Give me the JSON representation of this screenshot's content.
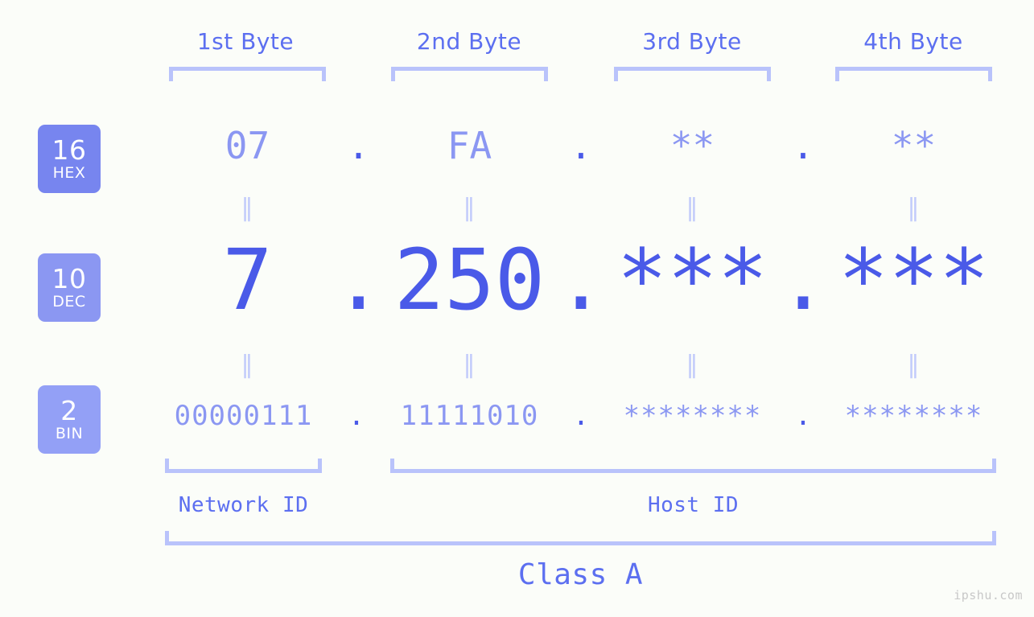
{
  "ip": {
    "hex": [
      "07",
      "FA",
      "**",
      "**"
    ],
    "dec": [
      "7",
      "250",
      "***",
      "***"
    ],
    "bin": [
      "00000111",
      "11111010",
      "********",
      "********"
    ],
    "separator": "."
  },
  "byte_headers": [
    {
      "label": "1st Byte"
    },
    {
      "label": "2nd Byte"
    },
    {
      "label": "3rd Byte"
    },
    {
      "label": "4th Byte"
    }
  ],
  "radix_badges": [
    {
      "number": "16",
      "name": "HEX",
      "color": "#7785ef"
    },
    {
      "number": "10",
      "name": "DEC",
      "color": "#8b97f2"
    },
    {
      "number": "2",
      "name": "BIN",
      "color": "#93a0f6"
    }
  ],
  "equals_glyph": "‖",
  "regions": {
    "network_id": "Network ID",
    "host_id": "Host ID",
    "class": "Class A"
  },
  "watermark": "ipshu.com",
  "colors": {
    "background": "#fbfdf9",
    "accent_dark": "#4a5ae8",
    "accent_mid": "#5c6ff0",
    "accent_light": "#8b97f2",
    "bracket": "#b9c3fb",
    "equals": "#c2cbfb",
    "watermark": "#c8c8c8"
  }
}
